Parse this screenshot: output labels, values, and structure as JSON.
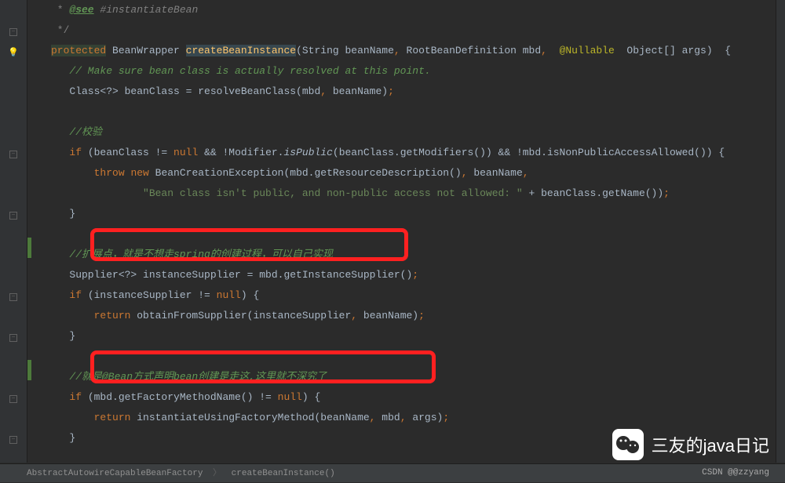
{
  "doc_comment": {
    "see_tag": "@see",
    "see_ref": " #instantiateBean",
    "close": " */"
  },
  "method_sig": {
    "modifier": "protected",
    "return_type": " BeanWrapper ",
    "name": "createBeanInstance",
    "params_a": "(String beanName",
    "comma1": ",",
    "params_b": " RootBeanDefinition mbd",
    "comma2": ",",
    "space": "  ",
    "ann": "@Nullable",
    "params_c": "  Object[] args)  {"
  },
  "comment_resolve": "// Make sure bean class is actually resolved at this point.",
  "line_class": {
    "a": "Class<?> beanClass = resolveBeanClass(mbd",
    "c1": ",",
    "b": " beanName)",
    "semi": ";"
  },
  "comment_check": "//校验",
  "line_if1": {
    "kw_if": "if",
    "a": " (beanClass != ",
    "kw_null": "null",
    "b": " && !Modifier.",
    "m": "isPublic",
    "c": "(beanClass.getModifiers()) && !mbd.isNonPublicAccessAllowed()) {"
  },
  "line_throw": {
    "kw_throw": "throw",
    "sp": " ",
    "kw_new": "new",
    "a": " BeanCreationException(mbd.getResourceDescription()",
    "c1": ",",
    "b": " beanName",
    "c2": ","
  },
  "line_string": {
    "str": "\"Bean class isn't public, and non-public access not allowed: \"",
    "a": " + beanClass.getName())",
    "semi": ";"
  },
  "brace_close": "}",
  "comment_ext": "//扩展点，就是不想走spring的创建过程，可以自己实现",
  "line_supplier": {
    "a": "Supplier<?> instanceSupplier = mbd.getInstanceSupplier()",
    "semi": ";"
  },
  "line_if2": {
    "kw_if": "if",
    "a": " (instanceSupplier != ",
    "kw_null": "null",
    "b": ") {"
  },
  "line_return1": {
    "kw": "return",
    "a": " obtainFromSupplier(instanceSupplier",
    "c1": ",",
    "b": " beanName)",
    "semi": ";"
  },
  "comment_bean": "//就是@Bean方式声明bean创建是走这,这里就不深究了",
  "line_if3": {
    "kw_if": "if",
    "a": " (mbd.getFactoryMethodName() != ",
    "kw_null": "null",
    "b": ") {"
  },
  "line_return2": {
    "kw": "return",
    "a": " instantiateUsingFactoryMethod(beanName",
    "c1": ",",
    "b": " mbd",
    "c2": ",",
    "d": " args)",
    "semi": ";"
  },
  "breadcrumb": {
    "a": "AbstractAutowireCapableBeanFactory",
    "b": "createBeanInstance()"
  },
  "watermark": {
    "text": "三友的java日记",
    "sub": "CSDN @@zzyang"
  }
}
